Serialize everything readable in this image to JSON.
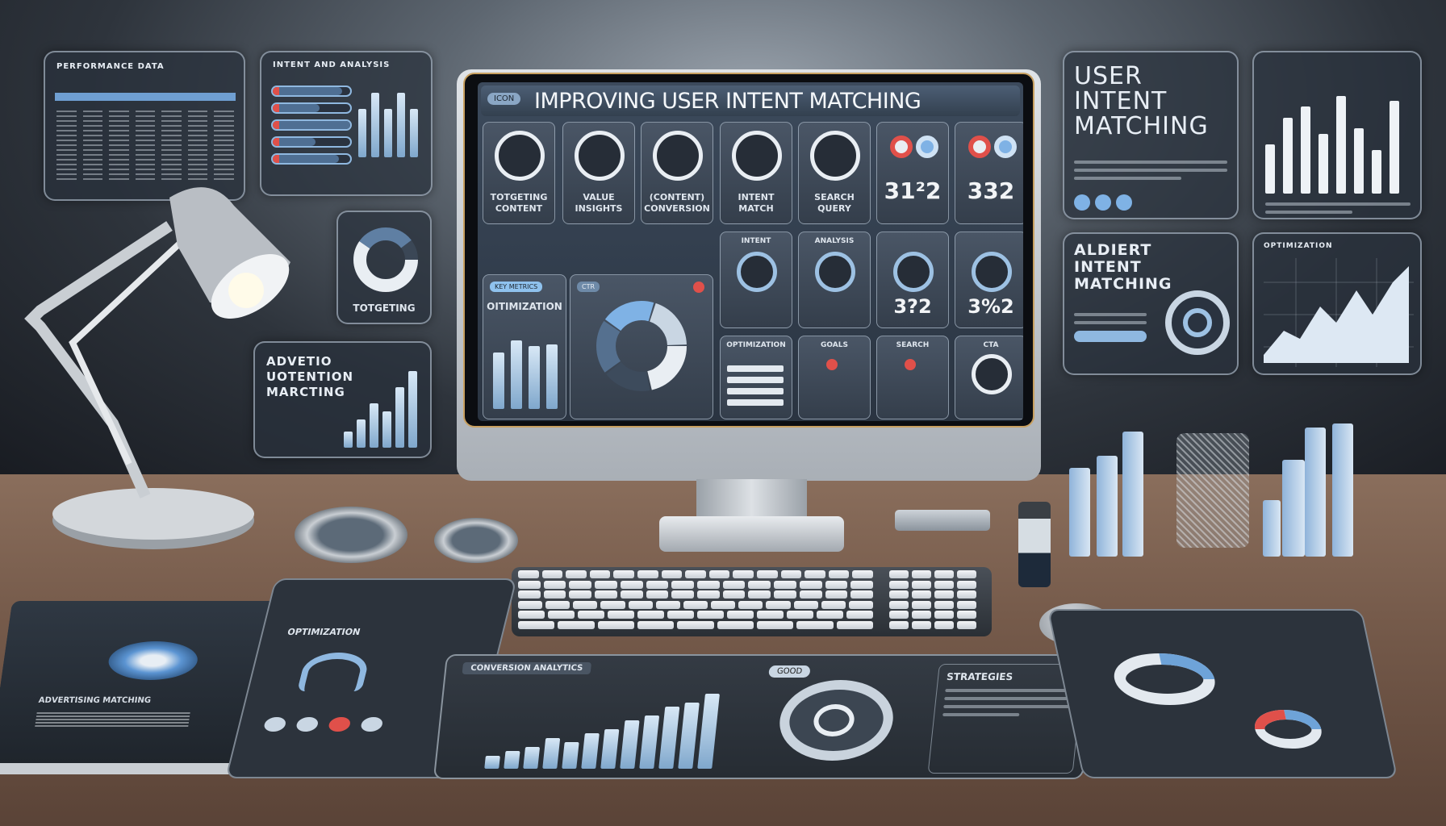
{
  "monitor": {
    "title": "IMPROVING USER INTENT MATCHING",
    "badge": "ICON",
    "tiles_row1": [
      {
        "label1": "TOTGETING",
        "label2": "CONTENT"
      },
      {
        "label1": "VALUE",
        "label2": "INSIGHTS"
      },
      {
        "label1": "(CONTENT)",
        "label2": "CONVERSION"
      },
      {
        "label1": "INTENT",
        "label2": "MATCH"
      },
      {
        "label1": "SEARCH",
        "label2": "QUERY"
      },
      {
        "label1": "",
        "label2": "",
        "number": "31²2"
      },
      {
        "label1": "",
        "label2": "",
        "number": "332"
      }
    ],
    "tiles_row2": [
      {
        "label": "INTENT"
      },
      {
        "label": "ANALYSIS"
      },
      {
        "label": "",
        "number": "3?2"
      },
      {
        "label": "",
        "number": "3%2"
      }
    ],
    "tiles_row3": [
      {
        "label": "OPTIMIZATION"
      },
      {
        "label": "GOALS"
      },
      {
        "label": "SEARCH"
      },
      {
        "label": "CTA"
      }
    ],
    "opt_panel": {
      "pill": "KEY METRICS",
      "title": "OITIMIZATION",
      "bars": [
        70,
        85,
        78,
        80
      ]
    },
    "donut_panel": {
      "badge": "CTR",
      "segments": [
        22,
        18,
        20,
        20,
        20
      ]
    }
  },
  "left_panels": {
    "table": {
      "title": "PERFORMANCE DATA",
      "columns": 7
    },
    "sliders": {
      "title": "INTENT AND ANALYSIS",
      "bars": [
        90,
        60,
        100,
        55,
        85
      ]
    },
    "donut": {
      "label": "TOTGETING"
    },
    "chart": {
      "title1": "ADVETIO",
      "title2": "UOTENTION",
      "title3": "MARCTING",
      "bars": [
        20,
        35,
        55,
        45,
        75,
        95
      ]
    }
  },
  "right_panels": {
    "main": {
      "title1": "USER",
      "title2": "INTENT",
      "title3": "MATCHING"
    },
    "bars": {
      "values": [
        45,
        70,
        80,
        55,
        90,
        60,
        40,
        85
      ]
    },
    "audit": {
      "title1": "ALDIERT",
      "title2": "INTENT",
      "title3": "MATCHING"
    },
    "area": {
      "title": "OPTIMIZATION"
    }
  },
  "desk": {
    "tablet": {
      "title": "CONVERSION ANALYTICS",
      "pill": "GOOD",
      "side_title": "STRATEGIES",
      "bars": [
        15,
        20,
        25,
        35,
        30,
        40,
        45,
        55,
        60,
        70,
        75,
        85
      ]
    },
    "left_tablet": {
      "title": "OPTIMIZATION"
    },
    "booklet": {
      "title": "ADVERTISING MATCHING"
    }
  },
  "colors": {
    "accent": "#7fb2e5",
    "red": "#e0504a",
    "panel": "#343e4b"
  }
}
